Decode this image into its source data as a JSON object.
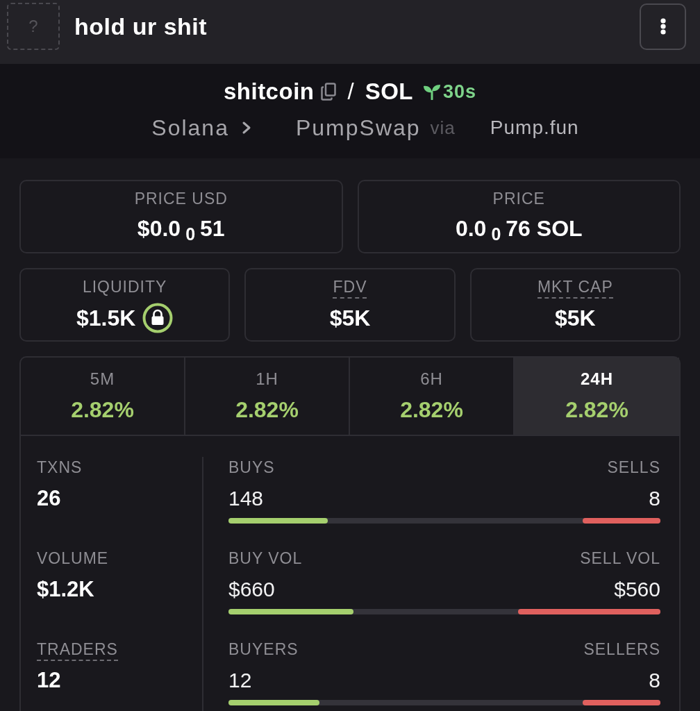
{
  "top_bar": {
    "image_placeholder": "?",
    "title": "hold ur shit"
  },
  "pair": {
    "base": "shitcoin",
    "separator": "/",
    "quote": "SOL",
    "age": "30s"
  },
  "route": {
    "chain": "Solana",
    "dex": "PumpSwap",
    "via": "via",
    "launchpad": "Pump.fun"
  },
  "price_cards": [
    {
      "label": "PRICE USD",
      "value": "$0.0$_{0}$51"
    },
    {
      "label": "PRICE",
      "value": "0.0$_{0}$76 SOL"
    }
  ],
  "metric_cards": [
    {
      "label": "LIQUIDITY",
      "value": "$1.5K",
      "underlined": false,
      "locked": true
    },
    {
      "label": "FDV",
      "value": "$5K",
      "underlined": true,
      "locked": false
    },
    {
      "label": "MKT CAP",
      "value": "$5K",
      "underlined": true,
      "locked": false
    }
  ],
  "periods": [
    {
      "label": "5M",
      "change": "2.82%",
      "selected": false
    },
    {
      "label": "1H",
      "change": "2.82%",
      "selected": false
    },
    {
      "label": "6H",
      "change": "2.82%",
      "selected": false
    },
    {
      "label": "24H",
      "change": "2.82%",
      "selected": true
    }
  ],
  "stats": [
    {
      "total": {
        "label": "TXNS",
        "value": "26",
        "underlined": false
      },
      "buy": {
        "label": "BUYS",
        "value": "148",
        "level": 0.23
      },
      "sell": {
        "label": "SELLS",
        "value": "8",
        "level": 0.18
      }
    },
    {
      "total": {
        "label": "VOLUME",
        "value": "$1.2K",
        "underlined": false
      },
      "buy": {
        "label": "BUY VOL",
        "value": "$660",
        "level": 0.29
      },
      "sell": {
        "label": "SELL VOL",
        "value": "$560",
        "level": 0.33
      }
    },
    {
      "total": {
        "label": "TRADERS",
        "value": "12",
        "underlined": true
      },
      "buy": {
        "label": "BUYERS",
        "value": "12",
        "level": 0.21
      },
      "sell": {
        "label": "SELLERS",
        "value": "8",
        "level": 0.18
      }
    }
  ]
}
